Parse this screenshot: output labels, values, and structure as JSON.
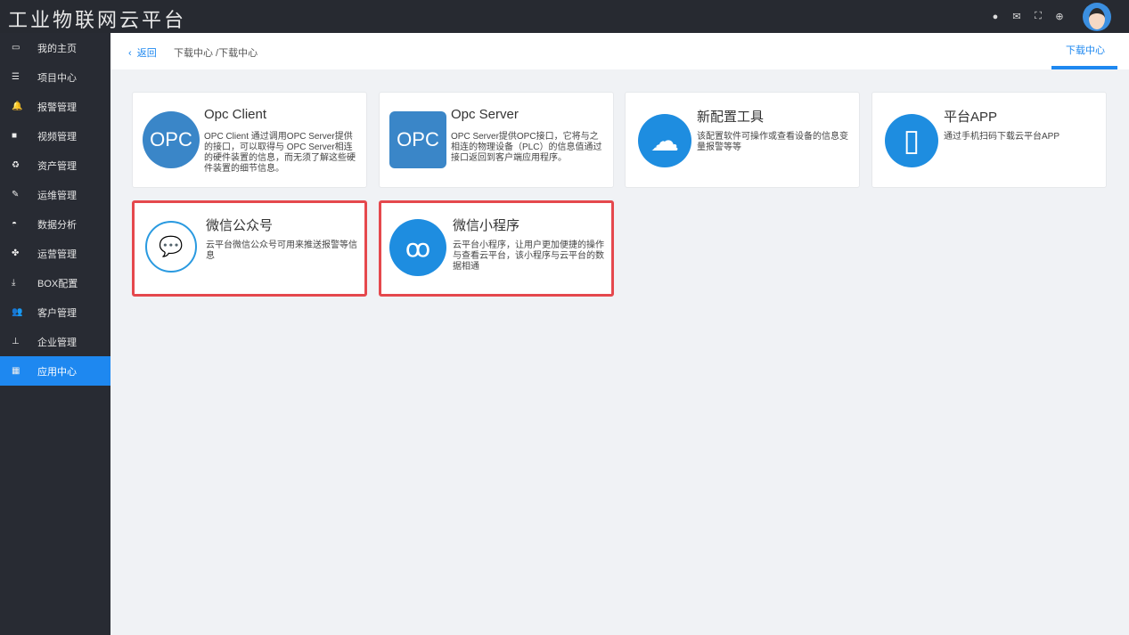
{
  "header": {
    "title": "工业物联网云平台",
    "icons": [
      "help-icon",
      "mail-icon",
      "fullscreen-icon",
      "globe-icon"
    ]
  },
  "sidebar": {
    "items": [
      {
        "label": "我的主页",
        "icon": "laptop-icon",
        "glyph": "▭"
      },
      {
        "label": "项目中心",
        "icon": "list-icon",
        "glyph": "☰"
      },
      {
        "label": "报警管理",
        "icon": "bell-icon",
        "glyph": "🔔"
      },
      {
        "label": "视频管理",
        "icon": "video-icon",
        "glyph": "■"
      },
      {
        "label": "资产管理",
        "icon": "recycle-icon",
        "glyph": "♻"
      },
      {
        "label": "运维管理",
        "icon": "wrench-icon",
        "glyph": "✎"
      },
      {
        "label": "数据分析",
        "icon": "dashboard-icon",
        "glyph": "◓"
      },
      {
        "label": "运营管理",
        "icon": "cubes-icon",
        "glyph": "✤"
      },
      {
        "label": "BOX配置",
        "icon": "download-icon",
        "glyph": "⤓"
      },
      {
        "label": "客户管理",
        "icon": "users-icon",
        "glyph": "👥"
      },
      {
        "label": "企业管理",
        "icon": "sitemap-icon",
        "glyph": "⊥"
      },
      {
        "label": "应用中心",
        "icon": "grid-icon",
        "glyph": "▦",
        "active": true
      }
    ]
  },
  "breadcrumb": {
    "back": "返回",
    "path": "下载中心 /下载中心",
    "tab": "下载中心"
  },
  "cards": [
    {
      "title": "Opc Client",
      "icon_text": "OPC",
      "desc": "OPC Client 通过调用OPC Server提供的接口，可以取得与 OPC Server相连的硬件装置的信息，而无须了解这些硬件装置的细节信息。"
    },
    {
      "title": "Opc Server",
      "icon_text": "OPC",
      "desc": "OPC Server提供OPC接口，它将与之相连的物理设备（PLC）的信息值通过接口返回到客户端应用程序。"
    },
    {
      "title": "新配置工具",
      "icon_text": "☁",
      "desc": "该配置软件可操作或查看设备的信息变量报警等等"
    },
    {
      "title": "平台APP",
      "icon_text": "▯",
      "desc": "通过手机扫码下载云平台APP"
    },
    {
      "title": "微信公众号",
      "icon_text": "💬",
      "desc": "云平台微信公众号可用来推送报警等信息"
    },
    {
      "title": "微信小程序",
      "icon_text": "ꝏ",
      "desc": "云平台小程序，让用户更加便捷的操作与查看云平台，该小程序与云平台的数据相通"
    }
  ]
}
